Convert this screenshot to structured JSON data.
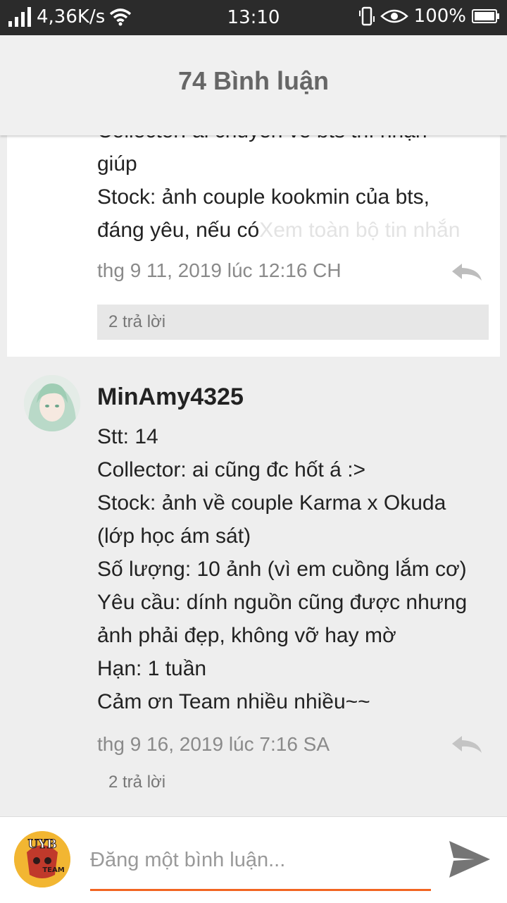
{
  "status_bar": {
    "speed": "4,36K/s",
    "time": "13:10",
    "battery": "100%"
  },
  "header": {
    "title": "74 Bình luận"
  },
  "comment1": {
    "lines": [
      "Collector: ai chuyên về bts thì nhận",
      "giúp",
      "Stock: ảnh couple kookmin của bts,",
      "đáng yêu, nếu có"
    ],
    "see_more": "Xem toàn bộ tin nhắn",
    "timestamp": "thg 9 11, 2019 lúc 12:16 CH",
    "replies": "2 trả lời"
  },
  "comment2": {
    "username": "MinAmy4325",
    "lines": [
      "Stt: 14",
      "Collector: ai cũng đc hốt á :>",
      "Stock: ảnh về couple Karma x Okuda",
      "(lớp học ám sát)",
      "Số lượng: 10 ảnh (vì em cuồng lắm cơ)",
      "Yêu cầu: dính nguồn cũng được nhưng",
      "ảnh phải đẹp, không vỡ hay mờ",
      "Hạn: 1 tuần",
      "Cảm ơn Team nhiều nhiều~~"
    ],
    "timestamp": "thg 9 16, 2019 lúc 7:16 SA",
    "replies": "2 trả lời"
  },
  "composer": {
    "avatar_text": "UYB",
    "avatar_sub": "TEAM",
    "placeholder": "Đăng một bình luận..."
  },
  "colors": {
    "accent": "#f26522",
    "status_bar": "#2b2b2b",
    "header_bg": "#f0f0f0",
    "title_text": "#666666"
  },
  "icons": {
    "signal": "signal-icon",
    "wifi": "wifi-icon",
    "vibrate": "vibrate-icon",
    "eye": "eye-icon",
    "battery": "battery-icon",
    "reply": "reply-icon",
    "send": "send-icon"
  }
}
